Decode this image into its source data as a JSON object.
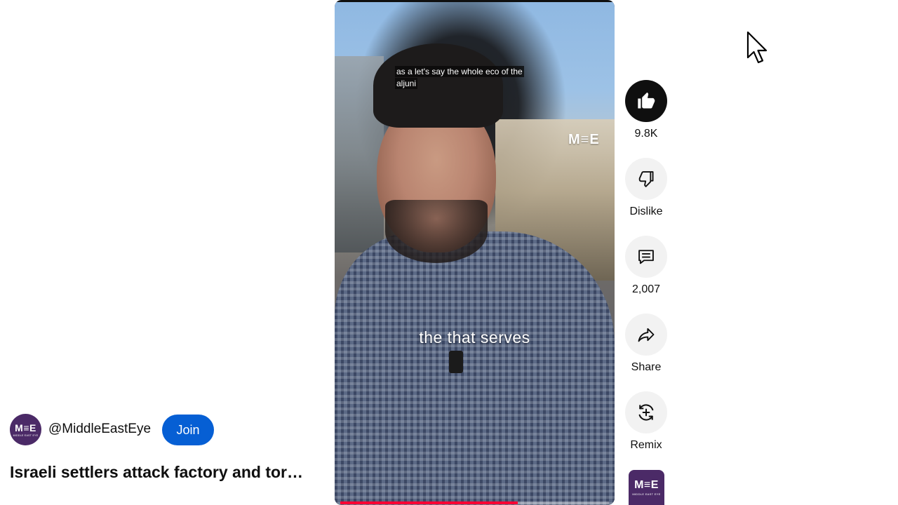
{
  "player": {
    "caption_top_line1": "as a let's say the whole eco of the",
    "caption_top_line2": "aljuni",
    "caption_main": "the that serves",
    "watermark": "M≡E",
    "progress_fraction": 0.66
  },
  "actions": {
    "like": {
      "label": "9.8K",
      "icon": "thumbs-up-icon",
      "active": true
    },
    "dislike": {
      "label": "Dislike",
      "icon": "thumbs-down-icon"
    },
    "comments": {
      "label": "2,007",
      "icon": "comment-icon"
    },
    "share": {
      "label": "Share",
      "icon": "share-arrow-icon"
    },
    "remix": {
      "label": "Remix",
      "icon": "remix-icon"
    }
  },
  "channel": {
    "handle": "@MiddleEastEye",
    "join_label": "Join",
    "logo_text": "M≡E",
    "logo_subtext": "MIDDLE EAST EYE"
  },
  "video": {
    "title": "Israeli settlers attack factory and tor…"
  },
  "colors": {
    "accent_blue": "#065fd4",
    "progress_red": "#ff0033",
    "brand_purple": "#4b2a67"
  }
}
